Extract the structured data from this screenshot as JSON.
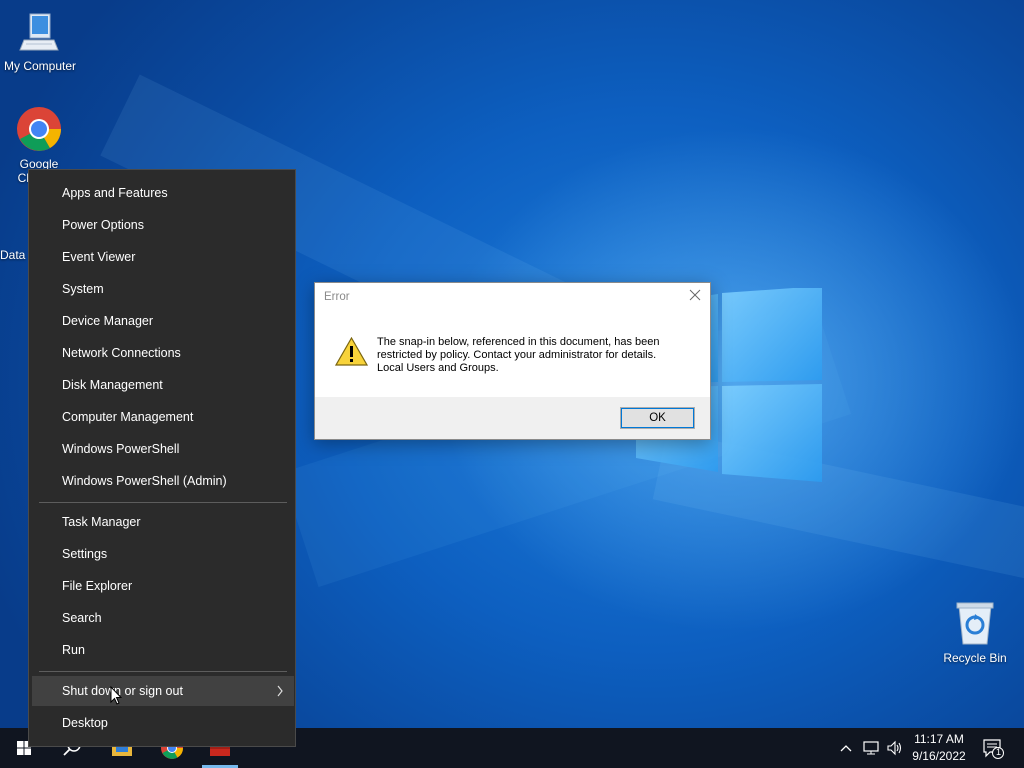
{
  "desktop": {
    "icons": [
      {
        "label": "My Computer"
      },
      {
        "label": "Google Chrome"
      },
      {
        "label": "Data"
      },
      {
        "label": "Recycle Bin"
      }
    ]
  },
  "winx_menu": {
    "group1": [
      "Apps and Features",
      "Power Options",
      "Event Viewer",
      "System",
      "Device Manager",
      "Network Connections",
      "Disk Management",
      "Computer Management",
      "Windows PowerShell",
      "Windows PowerShell (Admin)"
    ],
    "group2": [
      "Task Manager",
      "Settings",
      "File Explorer",
      "Search",
      "Run"
    ],
    "shutdown": "Shut down or sign out",
    "desktop": "Desktop"
  },
  "dialog": {
    "title": "Error",
    "message_line1": "The snap-in below, referenced in this document, has been",
    "message_line2": "restricted by policy. Contact your administrator for details.",
    "message_line3": "Local Users and Groups.",
    "ok_label": "OK"
  },
  "taskbar": {
    "time": "11:17 AM",
    "date": "9/16/2022",
    "notification_count": "1"
  },
  "colors": {
    "menu_bg": "#2b2b2b",
    "menu_hover": "#414141",
    "taskbar_bg": "#101520",
    "desktop_blue": "#0d5fc0",
    "accent": "#0078d7"
  }
}
